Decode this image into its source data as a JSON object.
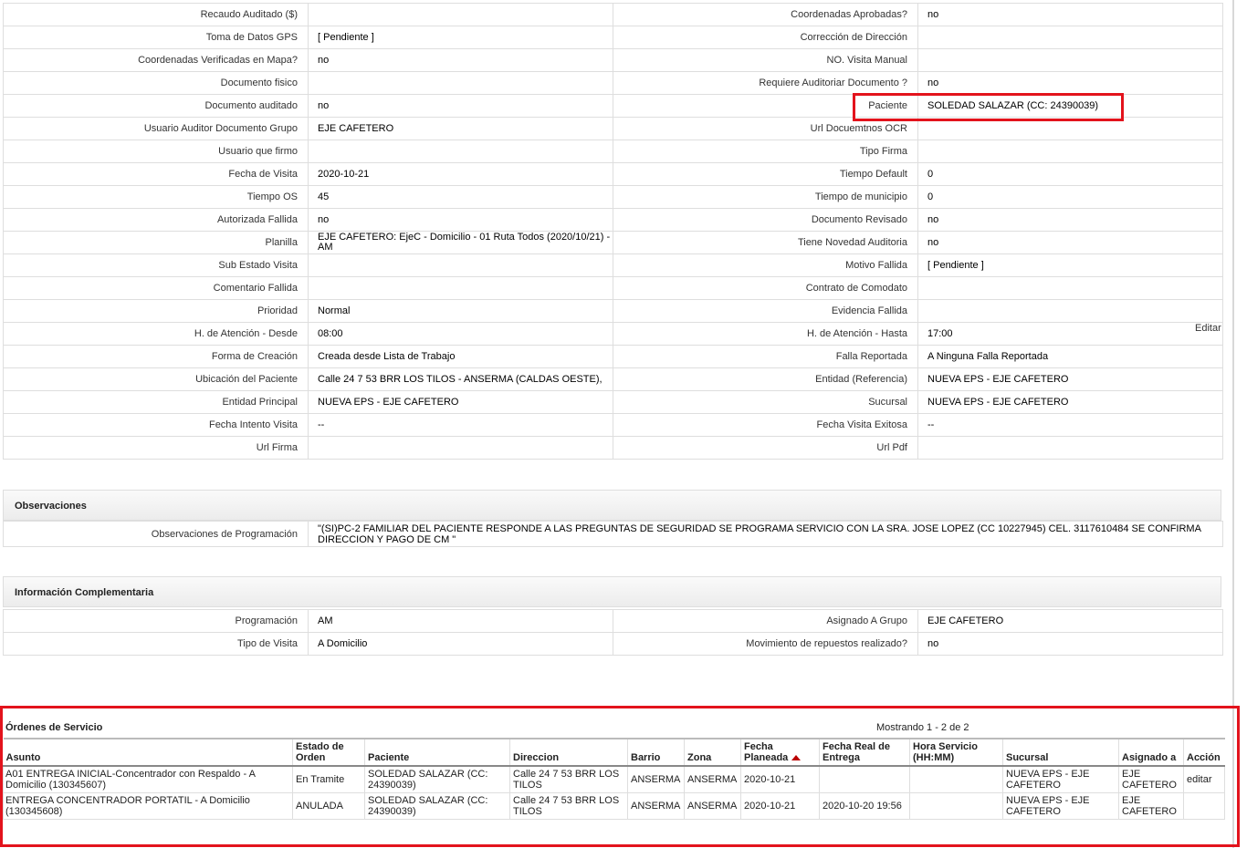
{
  "details": [
    {
      "l1": "Recaudo Auditado ($)",
      "v1": "",
      "l2": "Coordenadas Aprobadas?",
      "v2": "no"
    },
    {
      "l1": "Toma de Datos GPS",
      "v1": "[ Pendiente ]",
      "l2": "Corrección de Dirección",
      "v2": ""
    },
    {
      "l1": "Coordenadas Verificadas en Mapa?",
      "v1": "no",
      "l2": "NO. Visita Manual",
      "v2": ""
    },
    {
      "l1": "Documento fisico",
      "v1": "",
      "l2": "Requiere Auditoriar Documento ?",
      "v2": "no"
    },
    {
      "l1": "Documento auditado",
      "v1": "no",
      "l2": "Paciente",
      "v2": "SOLEDAD SALAZAR (CC: 24390039)"
    },
    {
      "l1": "Usuario Auditor Documento Grupo",
      "v1": "EJE CAFETERO",
      "l2": "Url Docuemtnos OCR",
      "v2": ""
    },
    {
      "l1": "Usuario que firmo",
      "v1": "",
      "l2": "Tipo Firma",
      "v2": ""
    },
    {
      "l1": "Fecha de Visita",
      "v1": "2020-10-21",
      "l2": "Tiempo Default",
      "v2": "0"
    },
    {
      "l1": "Tiempo OS",
      "v1": "45",
      "l2": "Tiempo de municipio",
      "v2": "0"
    },
    {
      "l1": "Autorizada Fallida",
      "v1": "no",
      "l2": "Documento Revisado",
      "v2": "no"
    },
    {
      "l1": "Planilla",
      "v1": "EJE CAFETERO: EjeC - Domicilio - 01 Ruta Todos (2020/10/21) - AM",
      "l2": "Tiene Novedad Auditoria",
      "v2": "no"
    },
    {
      "l1": "Sub Estado Visita",
      "v1": "",
      "l2": "Motivo Fallida",
      "v2": "[ Pendiente ]"
    },
    {
      "l1": "Comentario Fallida",
      "v1": "",
      "l2": "Contrato de Comodato",
      "v2": ""
    },
    {
      "l1": "Prioridad",
      "v1": "Normal",
      "l2": "Evidencia Fallida",
      "v2": ""
    },
    {
      "l1": "H. de Atención - Desde",
      "v1": "08:00",
      "l2": "H. de Atención - Hasta",
      "v2": "17:00"
    },
    {
      "l1": "Forma de Creación",
      "v1": "Creada desde Lista de Trabajo",
      "l2": "Falla Reportada",
      "v2": "A Ninguna Falla Reportada"
    },
    {
      "l1": "Ubicación del Paciente",
      "v1": "Calle 24 7 53 BRR LOS TILOS - ANSERMA (CALDAS OESTE),",
      "l2": "Entidad (Referencia)",
      "v2": "NUEVA EPS - EJE CAFETERO"
    },
    {
      "l1": "Entidad Principal",
      "v1": "NUEVA EPS - EJE CAFETERO",
      "l2": "Sucursal",
      "v2": "NUEVA EPS - EJE CAFETERO"
    },
    {
      "l1": "Fecha Intento Visita",
      "v1": "--",
      "l2": "Fecha Visita Exitosa",
      "v2": "--"
    },
    {
      "l1": "Url Firma",
      "v1": "",
      "l2": "Url Pdf",
      "v2": ""
    }
  ],
  "editar_label": "Editar",
  "observaciones": {
    "title": "Observaciones",
    "label": "Observaciones de Programación",
    "value": "\"(SI)PC-2 FAMILIAR DEL PACIENTE RESPONDE A LAS PREGUNTAS DE SEGURIDAD SE PROGRAMA SERVICIO CON LA SRA. JOSE LOPEZ (CC 10227945) CEL. 3117610484 SE CONFIRMA DIRECCION Y PAGO DE CM \""
  },
  "complementaria": {
    "title": "Información Complementaria",
    "rows": [
      {
        "l1": "Programación",
        "v1": "AM",
        "l2": "Asignado A Grupo",
        "v2": "EJE CAFETERO"
      },
      {
        "l1": "Tipo de Visita",
        "v1": "A Domicilio",
        "l2": "Movimiento de repuestos realizado?",
        "v2": "no"
      }
    ]
  },
  "ordenes": {
    "title": "Órdenes de Servicio",
    "count": "Mostrando 1 - 2 de 2",
    "headers": [
      "Asunto",
      "Estado de Orden",
      "Paciente",
      "Direccion",
      "Barrio",
      "Zona",
      "Fecha Planeada",
      "Fecha Real de Entrega",
      "Hora Servicio (HH:MM)",
      "Sucursal",
      "Asignado a",
      "Acción"
    ],
    "rows": [
      [
        "A01 ENTREGA INICIAL-Concentrador con Respaldo - A Domicilio (130345607)",
        "En Tramite",
        "SOLEDAD SALAZAR (CC: 24390039)",
        "Calle 24 7 53 BRR LOS TILOS",
        "ANSERMA",
        "ANSERMA",
        "2020-10-21",
        "",
        "",
        "NUEVA EPS - EJE CAFETERO",
        "EJE CAFETERO",
        "editar"
      ],
      [
        "ENTREGA CONCENTRADOR PORTATIL - A Domicilio (130345608)",
        "ANULADA",
        "SOLEDAD SALAZAR (CC: 24390039)",
        "Calle 24 7 53 BRR LOS TILOS",
        "ANSERMA",
        "ANSERMA",
        "2020-10-21",
        "2020-10-20 19:56",
        "",
        "NUEVA EPS - EJE CAFETERO",
        "EJE CAFETERO",
        ""
      ]
    ]
  },
  "colors": {
    "highlight": "#e3131c",
    "border": "#dedede",
    "link": "#1a4a8a"
  }
}
